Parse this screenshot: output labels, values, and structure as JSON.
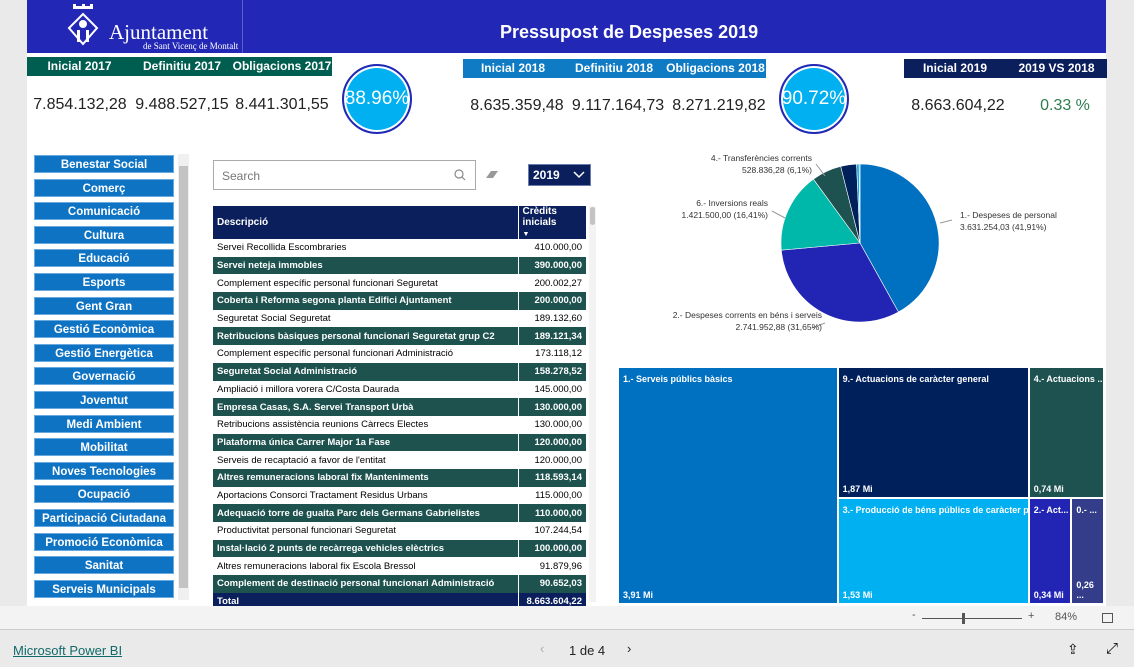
{
  "header": {
    "logo_name": "Ajuntament",
    "logo_sub": "de Sant Vicenç de Montalt",
    "title": "Pressupost de Despeses 2019"
  },
  "kpi2017": {
    "headers": [
      "Inicial 2017",
      "Definitiu 2017",
      "Obligacions 2017"
    ],
    "values": [
      "7.854.132,28",
      "9.488.527,15",
      "8.441.301,55"
    ],
    "gauge": "88.96%"
  },
  "kpi2018": {
    "headers": [
      "Inicial 2018",
      "Definitiu 2018",
      "Obligacions 2018"
    ],
    "values": [
      "8.635.359,48",
      "9.117.164,73",
      "8.271.219,82"
    ],
    "gauge": "90.72%"
  },
  "kpi2019": {
    "headers": [
      "Inicial 2019",
      "2019 VS 2018"
    ],
    "values": [
      "8.663.604,22",
      "0.33 %"
    ]
  },
  "colors": {
    "k2017": "#005e50",
    "k2018": "#0f7bc4",
    "k2019": "#0a1f5c",
    "positive": "#2e7d4f"
  },
  "sidebar": [
    "Benestar Social",
    "Comerç",
    "Comunicació",
    "Cultura",
    "Educació",
    "Esports",
    "Gent Gran",
    "Gestió Econòmica",
    "Gestió Energètica",
    "Governació",
    "Joventut",
    "Medi Ambient",
    "Mobilitat",
    "Noves Tecnologies",
    "Ocupació",
    "Participació Ciutadana",
    "Promoció Econòmica",
    "Sanitat",
    "Serveis Municipals"
  ],
  "search": {
    "placeholder": "Search"
  },
  "year_select": "2019",
  "table": {
    "headers": [
      "Descripció",
      "Crèdits inicials"
    ],
    "rows": [
      [
        "Servei Recollida Escombraries",
        "410.000,00"
      ],
      [
        "Servei neteja immobles",
        "390.000,00"
      ],
      [
        "Complement específic personal funcionari Seguretat",
        "200.002,27"
      ],
      [
        "Coberta i Reforma segona planta Edifici Ajuntament",
        "200.000,00"
      ],
      [
        "Seguretat Social Seguretat",
        "189.132,60"
      ],
      [
        "Retribucions bàsiques personal funcionari Seguretat grup C2",
        "189.121,34"
      ],
      [
        "Complement específic personal funcionari Administració",
        "173.118,12"
      ],
      [
        "Seguretat Social Administració",
        "158.278,52"
      ],
      [
        "Ampliació i millora vorera C/Costa Daurada",
        "145.000,00"
      ],
      [
        "Empresa Casas, S.A. Servei Transport Urbà",
        "130.000,00"
      ],
      [
        "Retribucions assistència reunions Càrrecs Electes",
        "130.000,00"
      ],
      [
        "Plataforma única Carrer Major 1a Fase",
        "120.000,00"
      ],
      [
        "Serveis de recaptació a favor de l'entitat",
        "120.000,00"
      ],
      [
        "Altres remuneracions laboral fix Manteniments",
        "118.593,14"
      ],
      [
        "Aportacions Consorci Tractament Residus Urbans",
        "115.000,00"
      ],
      [
        "Adequació torre de guaita Parc dels Germans Gabrielistes",
        "110.000,00"
      ],
      [
        "Productivitat personal funcionari Seguretat",
        "107.244,54"
      ],
      [
        "Instal·lació 2 punts de recàrrega vehicles elèctrics",
        "100.000,00"
      ],
      [
        "Altres remuneracions laboral fix Escola Bressol",
        "91.879,96"
      ],
      [
        "Complement de destinació personal funcionari Administració",
        "90.652,03"
      ]
    ],
    "total": [
      "Total",
      "8.663.604,22"
    ]
  },
  "chart_data": [
    {
      "type": "pie",
      "slices": [
        {
          "name": "1.- Despeses de personal",
          "label": "3.631.254,03 (41,91%)",
          "value": 3631254.03,
          "color": "#0070c0"
        },
        {
          "name": "2.- Despeses corrents en béns i serveis",
          "label": "2.741.952,88 (31,65%)",
          "value": 2741952.88,
          "color": "#2224b3"
        },
        {
          "name": "6.- Inversions reals",
          "label": "1.421.500,00 (16,41%)",
          "value": 1421500.0,
          "color": "#00b8aa"
        },
        {
          "name": "4.- Transferències corrents",
          "label": "528.836,28 (6,1%)",
          "value": 528836.28,
          "color": "#1e5250"
        },
        {
          "value": 280000,
          "color": "#00205b"
        },
        {
          "value": 45000,
          "color": "#00b0f0"
        },
        {
          "value": 15000,
          "color": "#2e3d8f"
        }
      ]
    },
    {
      "type": "treemap",
      "items": [
        {
          "name": "1.- Serveis públics bàsics",
          "label": "3,91 Mi",
          "value": 3.91,
          "color": "#0070c0"
        },
        {
          "name": "9.- Actuacions de caràcter general",
          "label": "1,87 Mi",
          "value": 1.87,
          "color": "#00205b"
        },
        {
          "name": "4.- Actuacions ...",
          "label": "0,74 Mi",
          "value": 0.74,
          "color": "#1e5250"
        },
        {
          "name": "3.- Producció de béns públics de caràcter p...",
          "label": "1,53 Mi",
          "value": 1.53,
          "color": "#00b0f0"
        },
        {
          "name": "2.- Act...",
          "label": "0,34 Mi",
          "value": 0.34,
          "color": "#2224b3"
        },
        {
          "name": "0.- ...",
          "label": "0,26 ...",
          "value": 0.26,
          "color": "#333d8a"
        }
      ]
    }
  ],
  "zoom": {
    "minus": "-",
    "plus": "+",
    "level": "84%",
    "level_value": 84
  },
  "footer": {
    "brand": "Microsoft Power BI",
    "page": "1 de 4"
  }
}
